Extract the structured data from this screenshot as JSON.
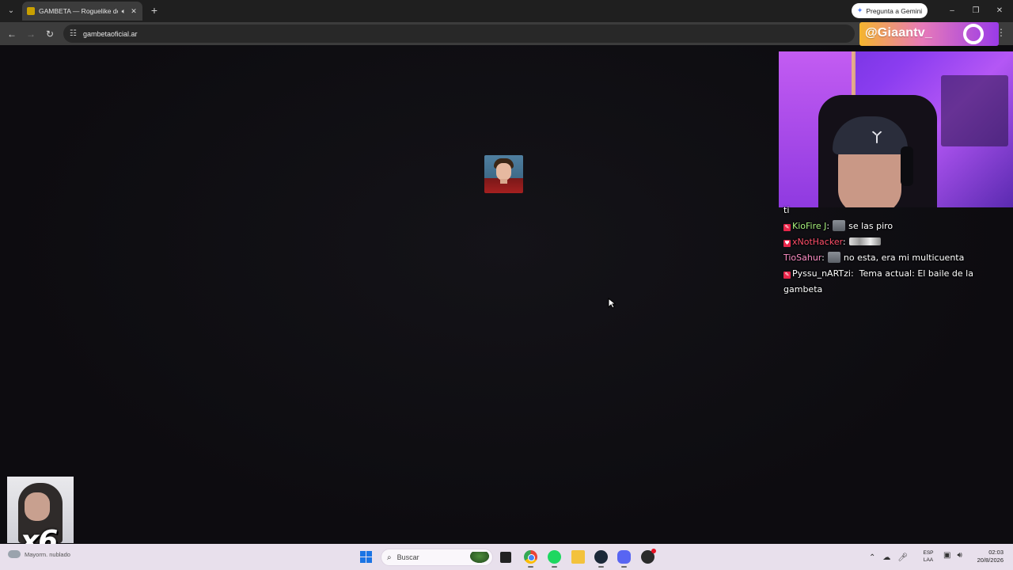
{
  "browser": {
    "tab_title": "GAMBETA — Roguelike de",
    "gemini_label": "Pregunta a Gemini",
    "url": "gambetaoficial.ar"
  },
  "overlay": {
    "handle": "@Giaantv_",
    "multiplier": "x6"
  },
  "chat": {
    "fragment": "ti",
    "messages": [
      {
        "user": "KioFire J",
        "text": "se las piro",
        "emote": true,
        "badge": true,
        "color": "#a6f07b"
      },
      {
        "user": "xNotHacker",
        "text": "",
        "emote_wide": true,
        "badge": true,
        "color": "#ff4f6a"
      },
      {
        "user": "TioSahur",
        "text": "no esta, era mi multicuenta",
        "emote": true,
        "badge": false,
        "color": "#ff8fc7"
      },
      {
        "user": "Pyssu_nARTzi",
        "text": "Tema actual: El baile de la gambeta",
        "emote": false,
        "badge": true,
        "color": "#ffffff"
      }
    ]
  },
  "taskbar": {
    "weather": "Mayorm. nublado",
    "search_label": "Buscar",
    "lang_top": "ESP",
    "lang_bottom": "LAA",
    "time": "02:03",
    "date": "20/8/2026"
  }
}
